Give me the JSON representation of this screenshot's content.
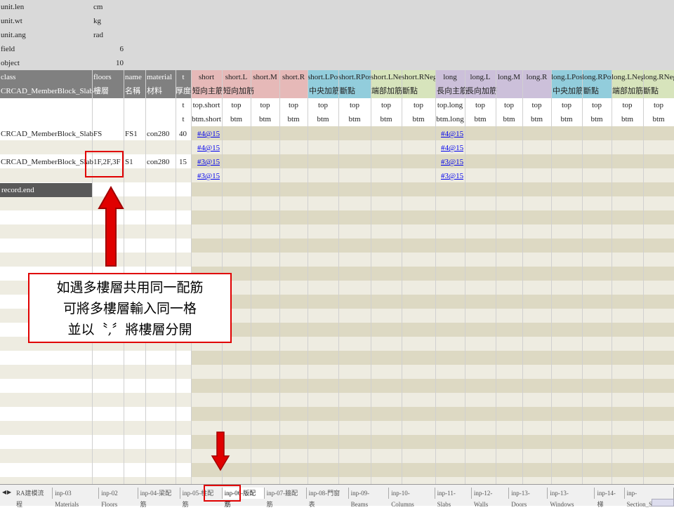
{
  "meta": {
    "rows": [
      {
        "key": "unit.len",
        "value": "cm"
      },
      {
        "key": "unit.wt",
        "value": "kg"
      },
      {
        "key": "unit.ang",
        "value": "rad"
      },
      {
        "key": "field",
        "value": "6"
      },
      {
        "key": "object",
        "value": "10"
      }
    ]
  },
  "headers": {
    "row1": [
      "class",
      "floors",
      "name",
      "material",
      "t",
      "short",
      "short.L",
      "short.M",
      "short.R",
      "short.LPos",
      "short.RPos",
      "short.LNeg",
      "short.RNeg",
      "long",
      "long.L",
      "long.M",
      "long.R",
      "long.LPos",
      "long.RPos",
      "long.LNeg",
      "long.RNeg"
    ],
    "row2": {
      "class": "CRCAD_MemberBlock_Slab",
      "floors": "樓層",
      "name": "名稱",
      "material": "材料",
      "t": "厚度",
      "short": "短向主筋",
      "shortL": "短向加筋",
      "shortPos": "中央加筋斷點",
      "shortNeg": "端部加筋斷點",
      "long": "長向主筋",
      "longL": "長向加筋",
      "longPos": "中央加筋斷點",
      "longNeg": "端部加筋斷點"
    },
    "row3": [
      "t",
      "top.short",
      "top",
      "top",
      "top",
      "top",
      "top",
      "top",
      "top",
      "top.long",
      "top",
      "top",
      "top",
      "top",
      "top",
      "top",
      "top"
    ],
    "row4": [
      "t",
      "btm.short",
      "btm",
      "btm",
      "btm",
      "btm",
      "btm",
      "btm",
      "btm",
      "btm.long",
      "btm",
      "btm",
      "btm",
      "btm",
      "btm",
      "btm",
      "btm"
    ]
  },
  "records": [
    {
      "class": "CRCAD_MemberBlock_Slab",
      "floors": "FS",
      "name": "FS1",
      "material": "con280",
      "t": "40",
      "short_top": "#4@15",
      "short_btm": "#4@15",
      "long_top": "#4@15",
      "long_btm": "#4@15"
    },
    {
      "class": "CRCAD_MemberBlock_Slab",
      "floors": "1F,2F,3F",
      "name": "S1",
      "material": "con280",
      "t": "15",
      "short_top": "#3@15",
      "short_btm": "#3@15",
      "long_top": "#3@15",
      "long_btm": "#3@15"
    }
  ],
  "record_end": "record.end",
  "callout": {
    "line1": "如遇多樓層共用同一配筋",
    "line2": "可將多樓層輸入同一格",
    "line3": "並以〝,〞將樓層分開"
  },
  "tabs": [
    "RA建模流程",
    "inp-03 Materials",
    "inp-02 Floors",
    "inp-04-梁配筋",
    "inp-05-柱配筋",
    "inp-06-版配筋",
    "inp-07-牆配筋",
    "inp-08-門窗表",
    "inp-09-Beams",
    "inp-10-Columns",
    "inp-11-Slabs",
    "inp-12-Walls",
    "inp-13-Doors",
    "inp-13-Windows",
    "inp-14-梯",
    "inp-Section_Steel"
  ],
  "active_tab": "inp-06-版配筋",
  "colors": {
    "short": "#e6b9b8",
    "pos": "#92cddc",
    "neg": "#d7e4bc",
    "long": "#ccc0da",
    "header": "#808080",
    "annotation": "#e00000"
  }
}
